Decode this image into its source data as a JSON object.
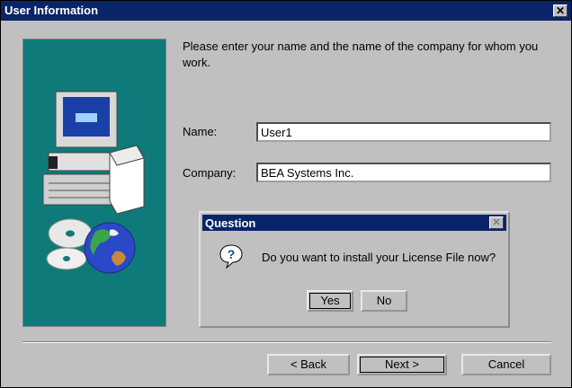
{
  "window": {
    "title": "User Information"
  },
  "intro_text": "Please enter your name and the name of the company for whom you work.",
  "form": {
    "name_label": "Name:",
    "name_value": "User1",
    "company_label": "Company:",
    "company_value": "BEA Systems Inc."
  },
  "dialog": {
    "title": "Question",
    "message": "Do you want to install your License File now?",
    "yes_label": "Yes",
    "no_label": "No"
  },
  "buttons": {
    "back_label": "< Back",
    "next_label": "Next >",
    "cancel_label": "Cancel"
  },
  "colors": {
    "titlebar": "#0a246a",
    "art_background": "#0e7a7a",
    "window_background": "#c0c0c0"
  },
  "icons": [
    "close-icon",
    "computer-illustration",
    "cd-illustration",
    "globe-illustration",
    "question-icon"
  ]
}
